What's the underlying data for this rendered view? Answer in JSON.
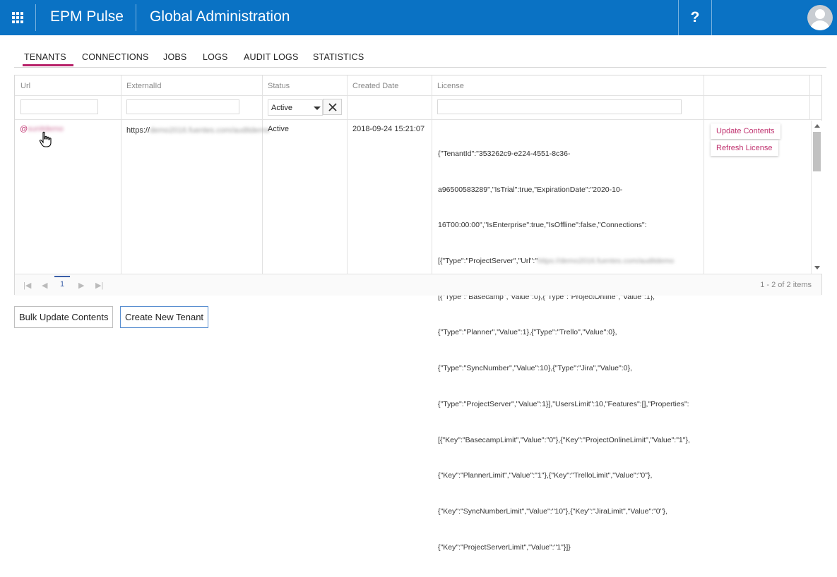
{
  "header": {
    "brand": "EPM Pulse",
    "title": "Global Administration",
    "help_label": "?",
    "bg_color": "#0a72c4"
  },
  "tabs": [
    {
      "label": "TENANTS",
      "active": true
    },
    {
      "label": "CONNECTIONS"
    },
    {
      "label": "JOBS"
    },
    {
      "label": "LOGS"
    },
    {
      "label": "AUDIT LOGS"
    },
    {
      "label": "STATISTICS"
    }
  ],
  "grid": {
    "columns": [
      "Url",
      "ExternalId",
      "Status",
      "Created Date",
      "License"
    ],
    "status_filter": "Active",
    "rows": [
      {
        "url_prefix": "@",
        "url": "sunitdemo",
        "external_id_prefix": "https://",
        "external_id": "demo2016.fuentes.com/auditdemo",
        "status": "Active",
        "created_date": "2018-09-24 15:21:07",
        "license_lines": [
          "{\"TenantId\":\"353262c9-e224-4551-8c36-",
          "a96500583289\",\"IsTrial\":true,\"ExpirationDate\":\"2020-10-",
          "16T00:00:00\",\"IsEnterprise\":true,\"IsOffline\":false,\"Connections\":",
          "[{\"Type\":\"ProjectServer\",\"Url\":\"",
          "[{\"Type\":\"Basecamp\",\"Value\":0},{\"Type\":\"ProjectOnline\",\"Value\":1},",
          "{\"Type\":\"Planner\",\"Value\":1},{\"Type\":\"Trello\",\"Value\":0},",
          "{\"Type\":\"SyncNumber\",\"Value\":10},{\"Type\":\"Jira\",\"Value\":0},",
          "{\"Type\":\"ProjectServer\",\"Value\":1}],\"UsersLimit\":10,\"Features\":[],\"Properties\":",
          "[{\"Key\":\"BasecampLimit\",\"Value\":\"0\"},{\"Key\":\"ProjectOnlineLimit\",\"Value\":\"1\"},",
          "{\"Key\":\"PlannerLimit\",\"Value\":\"1\"},{\"Key\":\"TrelloLimit\",\"Value\":\"0\"},",
          "{\"Key\":\"SyncNumberLimit\",\"Value\":\"10\"},{\"Key\":\"JiraLimit\",\"Value\":\"0\"},",
          "{\"Key\":\"ProjectServerLimit\",\"Value\":\"1\"}]}"
        ],
        "license_blurred": "https://demo2016.fuentes.com/auditdemo",
        "actions": {
          "update": "Update Contents",
          "refresh": "Refresh License"
        }
      }
    ]
  },
  "pager": {
    "current_page": "1",
    "info": "1 - 2 of 2 items"
  },
  "buttons": {
    "bulk_update": "Bulk Update Contents",
    "create_tenant": "Create New Tenant"
  },
  "colors": {
    "accent": "#b8236a",
    "link": "#c0326f"
  }
}
